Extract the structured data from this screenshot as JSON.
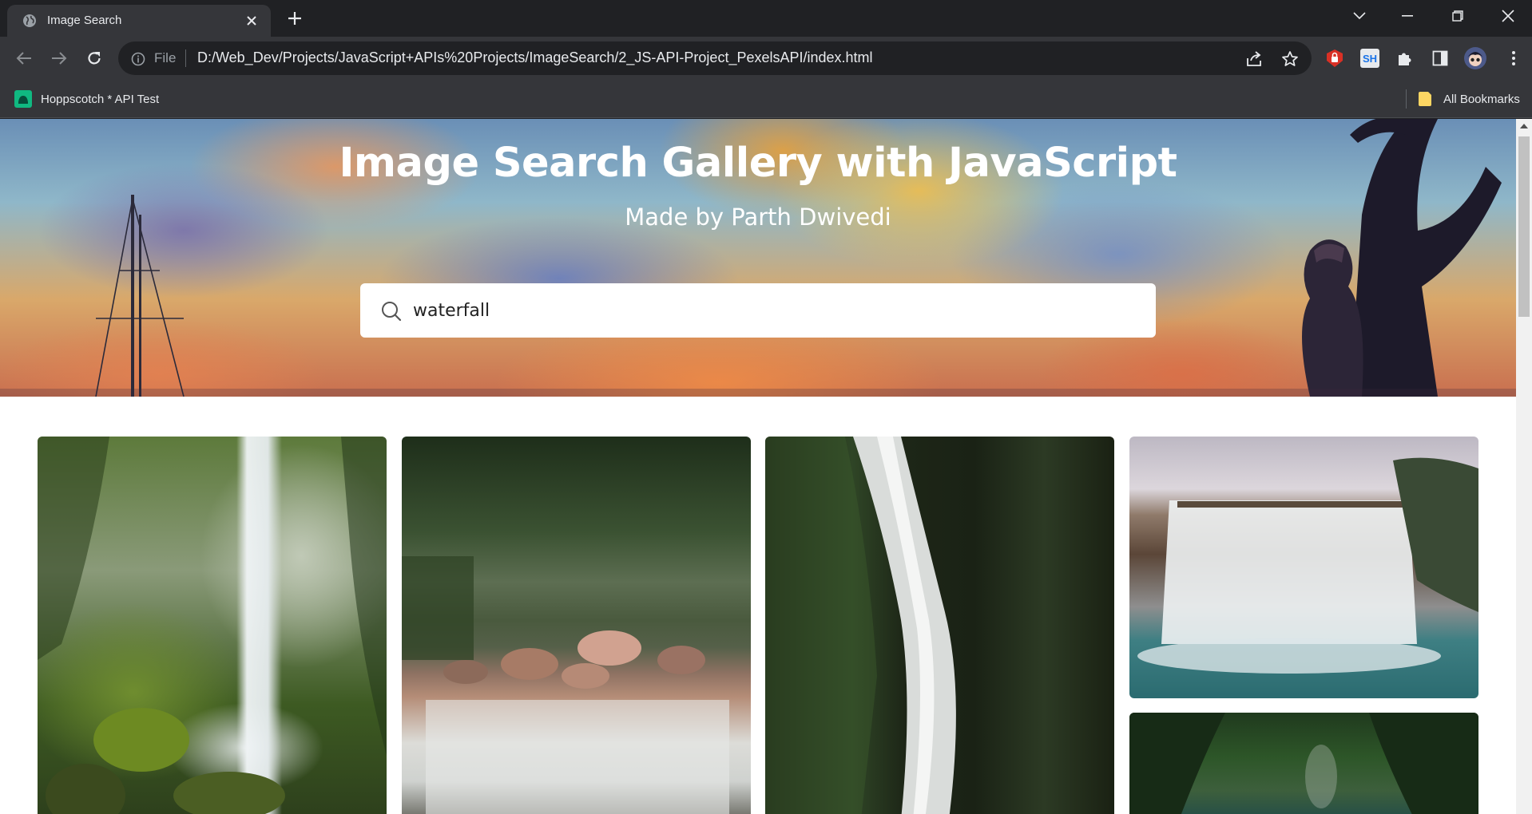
{
  "browser": {
    "tab": {
      "title": "Image Search"
    },
    "url": "D:/Web_Dev/Projects/JavaScript+APIs%20Projects/ImageSearch/2_JS-API-Project_PexelsAPI/index.html",
    "url_scheme_chip": "File",
    "extensions": {
      "sh_label": "SH"
    },
    "bookmarks": [
      {
        "label": "Hoppscotch * API Test",
        "icon": "hoppscotch-icon"
      },
      {
        "label": "All Bookmarks",
        "icon": "folder-icon"
      }
    ]
  },
  "page": {
    "title": "Image Search Gallery with JavaScript",
    "subtitle": "Made by Parth Dwivedi",
    "search": {
      "value": "waterfall",
      "icon": "search-icon"
    }
  },
  "gallery": [
    {
      "alt": "Forest waterfall with mossy rocks",
      "palette": [
        "#3d5a2a",
        "#a9b79a",
        "#6c8c3a",
        "#e8ecee"
      ]
    },
    {
      "alt": "Stream over rocks in forest",
      "palette": [
        "#263b20",
        "#6b7a55",
        "#b98c6e",
        "#d9dcd6"
      ]
    },
    {
      "alt": "Tall waterfall in dark gorge",
      "palette": [
        "#1c2618",
        "#3f5a30",
        "#cfd3d1",
        "#2a3a22"
      ]
    },
    {
      "alt": "Wide waterfall into turquoise pool",
      "palette": [
        "#c9c1c6",
        "#5c4a3e",
        "#e6eef0",
        "#2f6f74"
      ]
    },
    {
      "alt": "Green canyon with river",
      "palette": [
        "#1c3a1c",
        "#2f5a2c",
        "#4f6f4f",
        "#1e4a4a"
      ]
    }
  ]
}
